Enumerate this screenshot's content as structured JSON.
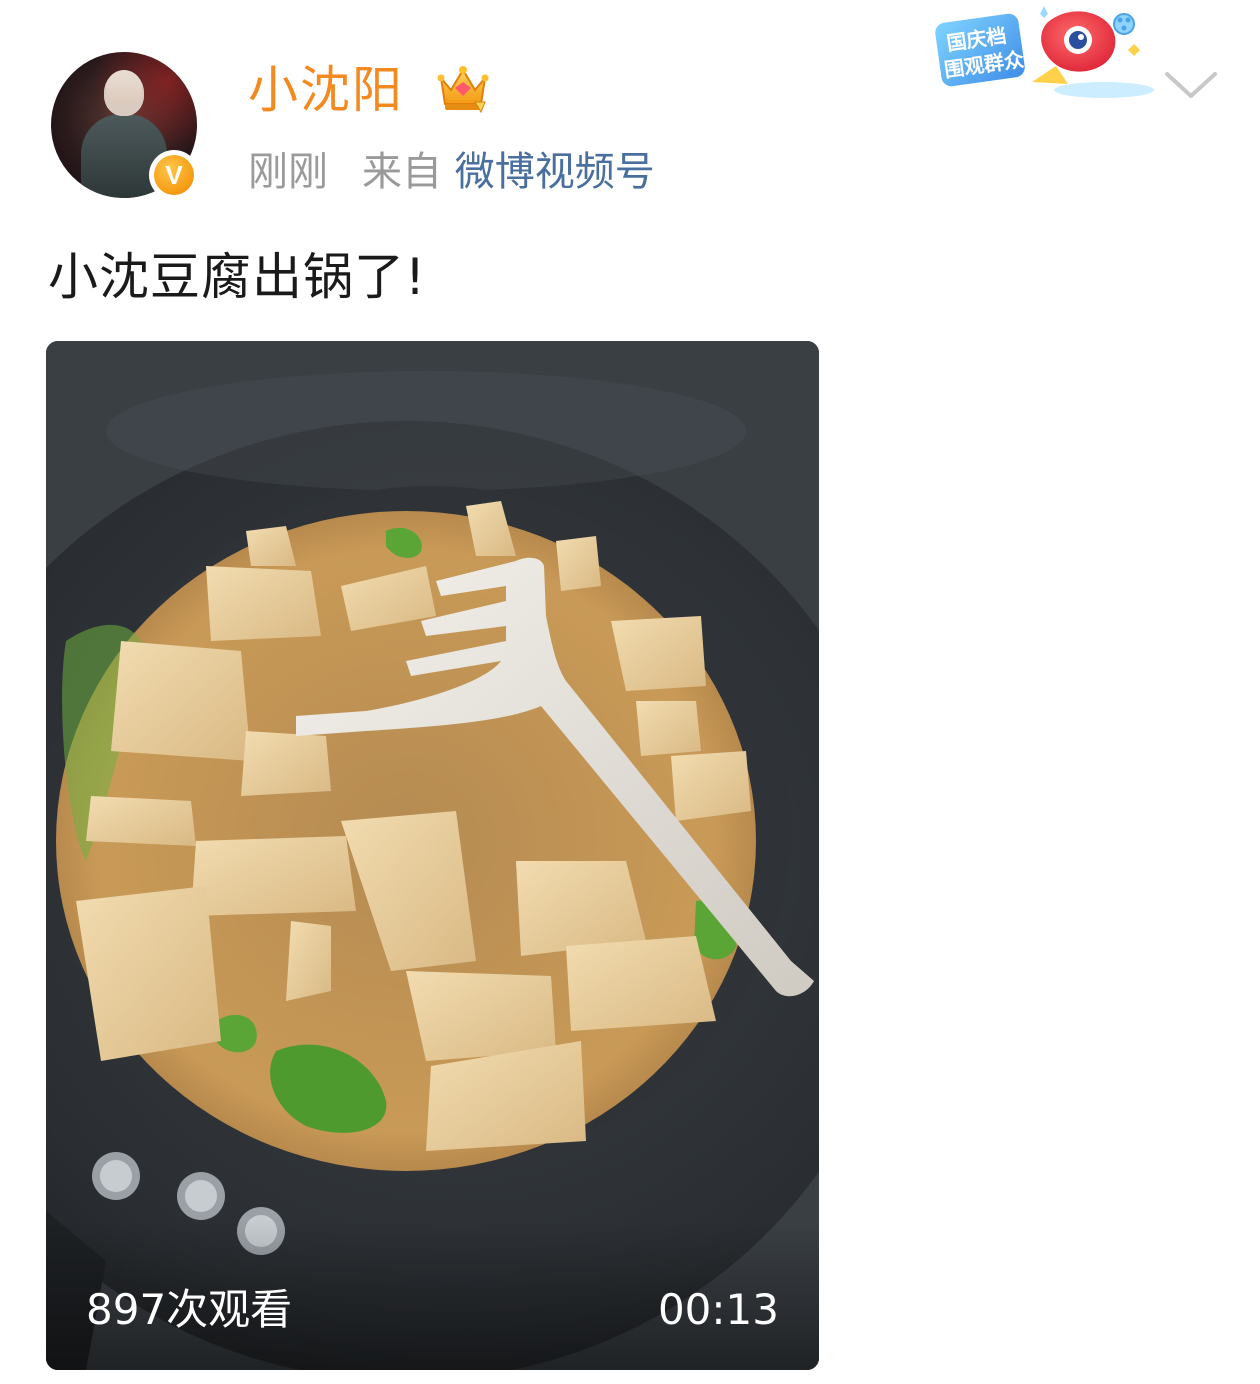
{
  "post": {
    "author": "小沈阳",
    "verified_badge": "V",
    "time": "刚刚",
    "source_prefix": "来自",
    "source_name": "微博视频号",
    "text": "小沈豆腐出锅了!",
    "badge_text_line1": "国庆档",
    "badge_text_line2": "围观群众"
  },
  "video": {
    "views": "897次观看",
    "duration": "00:13"
  },
  "icons": {
    "avatar": "avatar-icon",
    "verified": "verified-v-icon",
    "crown": "crown-icon",
    "more": "chevron-down-icon",
    "event_badge": "event-badge-icon"
  },
  "colors": {
    "username": "#f28a1f",
    "source_link": "#4a6f9f",
    "meta_gray": "#9a9a9a",
    "verified": "#f59a12"
  }
}
